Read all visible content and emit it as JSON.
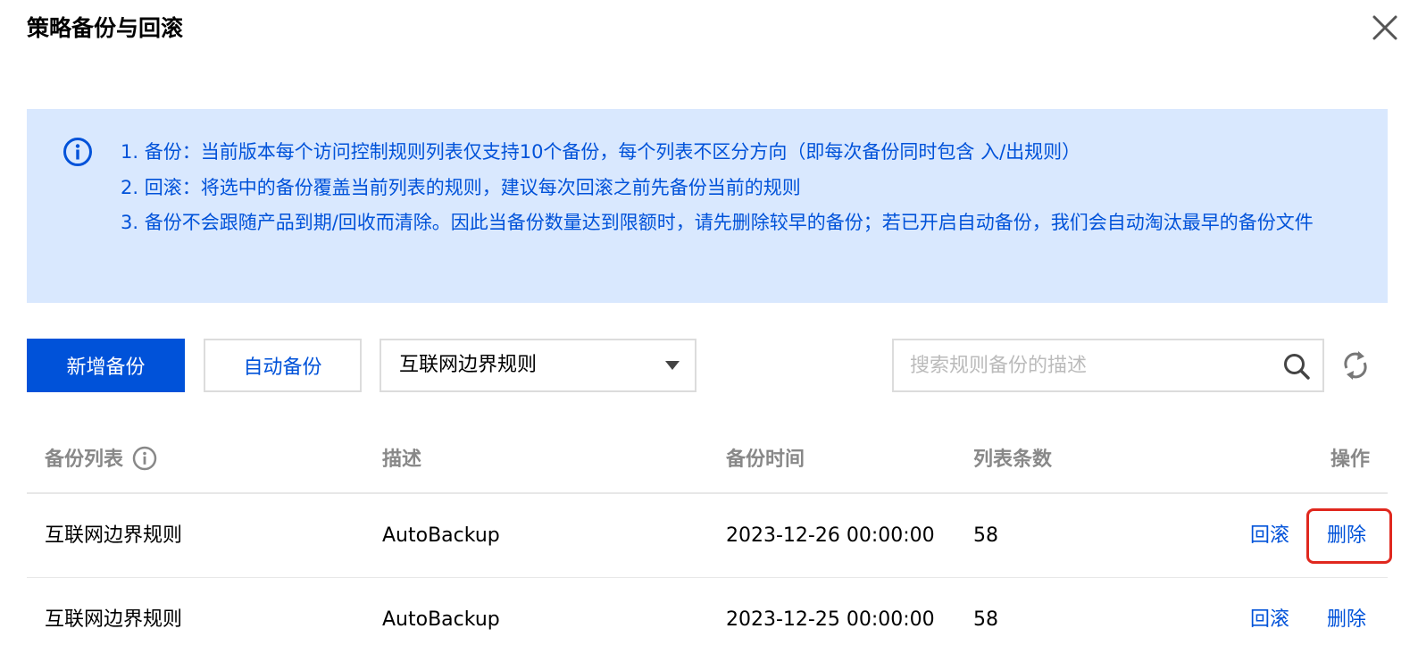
{
  "dialog": {
    "title": "策略备份与回滚"
  },
  "notice": {
    "lines": [
      "1. 备份：当前版本每个访问控制规则列表仅支持10个备份，每个列表不区分方向（即每次备份同时包含 入/出规则）",
      "2. 回滚：将选中的备份覆盖当前列表的规则，建议每次回滚之前先备份当前的规则",
      "3. 备份不会跟随产品到期/回收而清除。因此当备份数量达到限额时，请先删除较早的备份；若已开启自动备份，我们会自动淘汰最早的备份文件"
    ]
  },
  "toolbar": {
    "add_backup_label": "新增备份",
    "auto_backup_label": "自动备份",
    "rule_select_value": "互联网边界规则",
    "search_placeholder": "搜索规则备份的描述",
    "search_value": ""
  },
  "table": {
    "headers": [
      "备份列表",
      "描述",
      "备份时间",
      "列表条数",
      "操作"
    ],
    "rows": [
      {
        "list": "互联网边界规则",
        "description": "AutoBackup",
        "time": "2023-12-26 00:00:00",
        "count": "58",
        "rollback": "回滚",
        "delete": "删除"
      },
      {
        "list": "互联网边界规则",
        "description": "AutoBackup",
        "time": "2023-12-25 00:00:00",
        "count": "58",
        "rollback": "回滚",
        "delete": "删除"
      }
    ]
  },
  "colors": {
    "primary": "#0052d9",
    "notice_bg": "#d9e8fe",
    "highlight": "#e0281e"
  },
  "icons": [
    "close-icon",
    "info-icon",
    "chevron-down-icon",
    "search-icon",
    "refresh-icon"
  ]
}
